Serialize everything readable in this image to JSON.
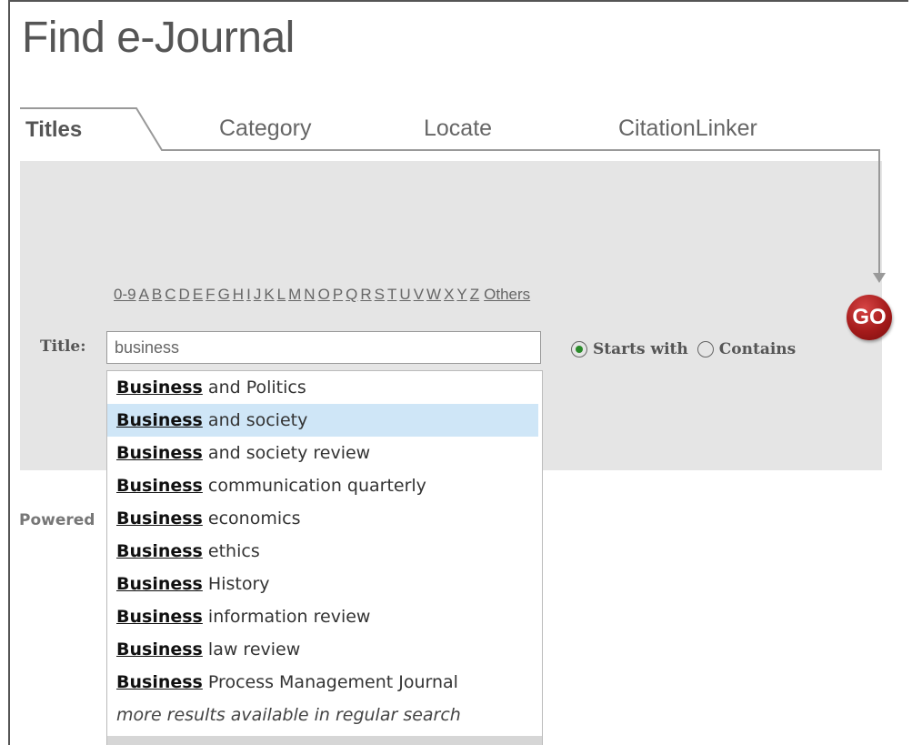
{
  "page": {
    "title": "Find e-Journal"
  },
  "tabs": [
    {
      "label": "Titles",
      "active": true
    },
    {
      "label": "Category"
    },
    {
      "label": "Locate"
    },
    {
      "label": "CitationLinker"
    }
  ],
  "alphabet": [
    "0-9",
    "A",
    "B",
    "C",
    "D",
    "E",
    "F",
    "G",
    "H",
    "I",
    "J",
    "K",
    "L",
    "M",
    "N",
    "O",
    "P",
    "Q",
    "R",
    "S",
    "T",
    "U",
    "V",
    "W",
    "X",
    "Y",
    "Z",
    "Others"
  ],
  "search": {
    "label": "Title:",
    "value": "business",
    "options": [
      {
        "label": "Starts with",
        "selected": true
      },
      {
        "label": "Contains",
        "selected": false
      }
    ],
    "go_label": "GO"
  },
  "powered_text": "Powered",
  "suggestions": {
    "match": "Business",
    "highlighted_index": 1,
    "items": [
      "and Politics",
      "and society",
      "and society review",
      "communication quarterly",
      "economics",
      "ethics",
      "History",
      "information review",
      "law review",
      "Process Management Journal"
    ],
    "more": "more results available in regular search"
  },
  "colors": {
    "panel": "#e5e5e5",
    "highlight": "#cfe6f7",
    "go": "#a51b1b",
    "radio_dot": "#2a8a2a"
  }
}
